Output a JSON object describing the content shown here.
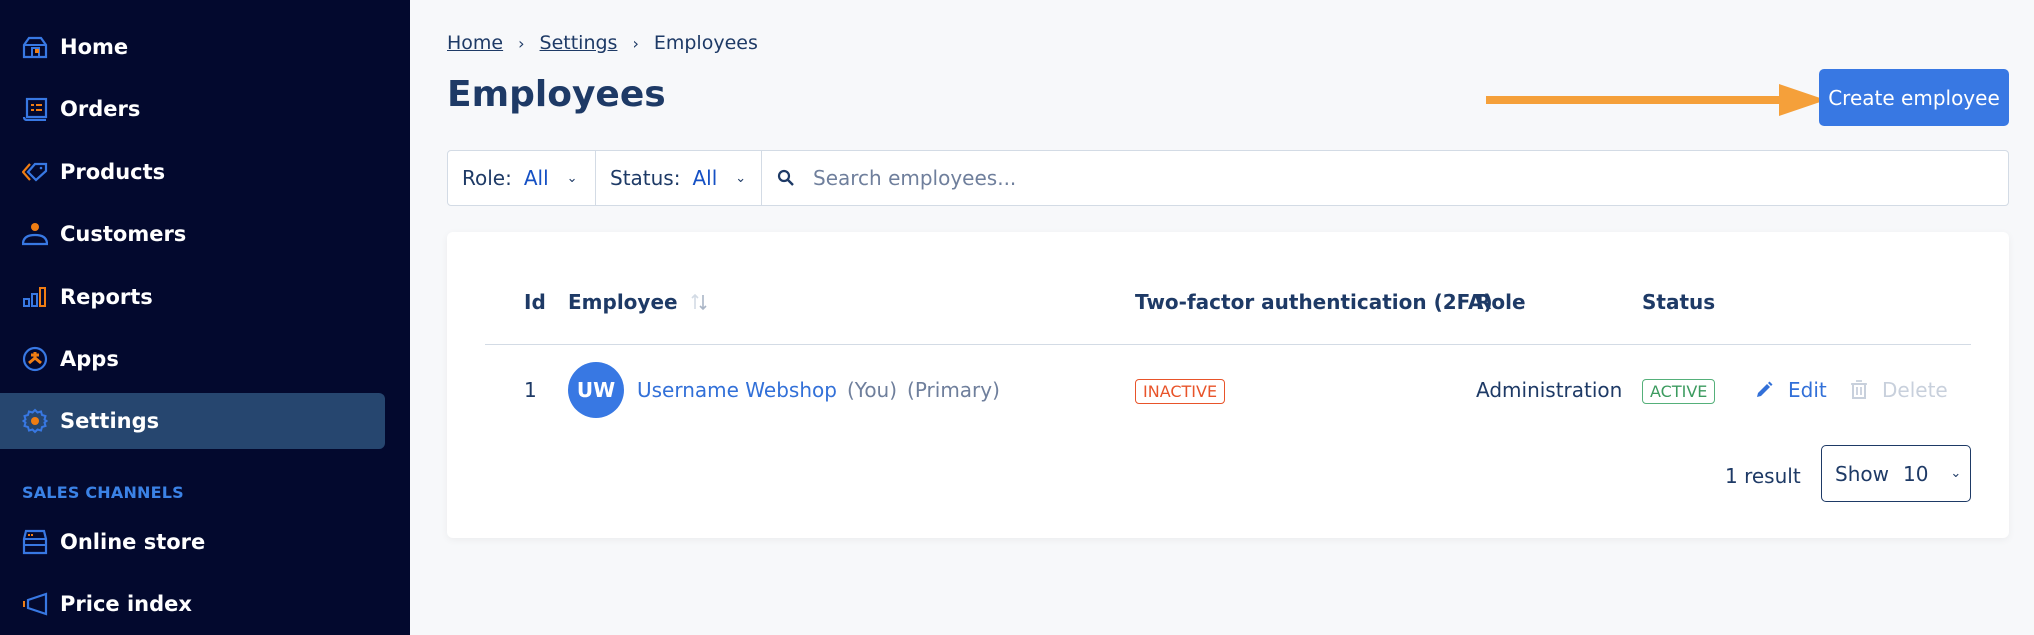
{
  "sidebar": {
    "items": [
      {
        "label": "Home",
        "icon": "home-icon"
      },
      {
        "label": "Orders",
        "icon": "orders-icon"
      },
      {
        "label": "Products",
        "icon": "tag-icon"
      },
      {
        "label": "Customers",
        "icon": "user-icon"
      },
      {
        "label": "Reports",
        "icon": "bar-chart-icon"
      },
      {
        "label": "Apps",
        "icon": "apps-icon"
      },
      {
        "label": "Settings",
        "icon": "gear-icon",
        "active": true
      }
    ],
    "section_title": "SALES CHANNELS",
    "channels": [
      {
        "label": "Online store",
        "icon": "store-icon"
      },
      {
        "label": "Price index",
        "icon": "megaphone-icon"
      }
    ]
  },
  "breadcrumb": [
    "Home",
    "Settings",
    "Employees"
  ],
  "page_title": "Employees",
  "create_button": "Create employee",
  "filters": {
    "role_label": "Role:",
    "role_value": "All",
    "status_label": "Status:",
    "status_value": "All",
    "search_placeholder": "Search employees..."
  },
  "table": {
    "headers": [
      "Id",
      "Employee",
      "Two-factor authentication (2FA)",
      "Role",
      "Status"
    ],
    "rows": [
      {
        "id": "1",
        "initials": "UW",
        "name": "Username Webshop",
        "tags": [
          "(You)",
          "(Primary)"
        ],
        "two_fa": "INACTIVE",
        "role": "Administration",
        "status": "ACTIVE",
        "edit_label": "Edit",
        "delete_label": "Delete"
      }
    ]
  },
  "footer": {
    "result_count": "1 result",
    "show_label": "Show",
    "show_value": "10"
  },
  "colors": {
    "sidebar_bg": "#03092e",
    "accent": "#3878e3",
    "icon_orange": "#f07d13",
    "annotation_arrow": "#f5a03a",
    "inactive": "#e8542a",
    "active": "#3c9b5f"
  }
}
